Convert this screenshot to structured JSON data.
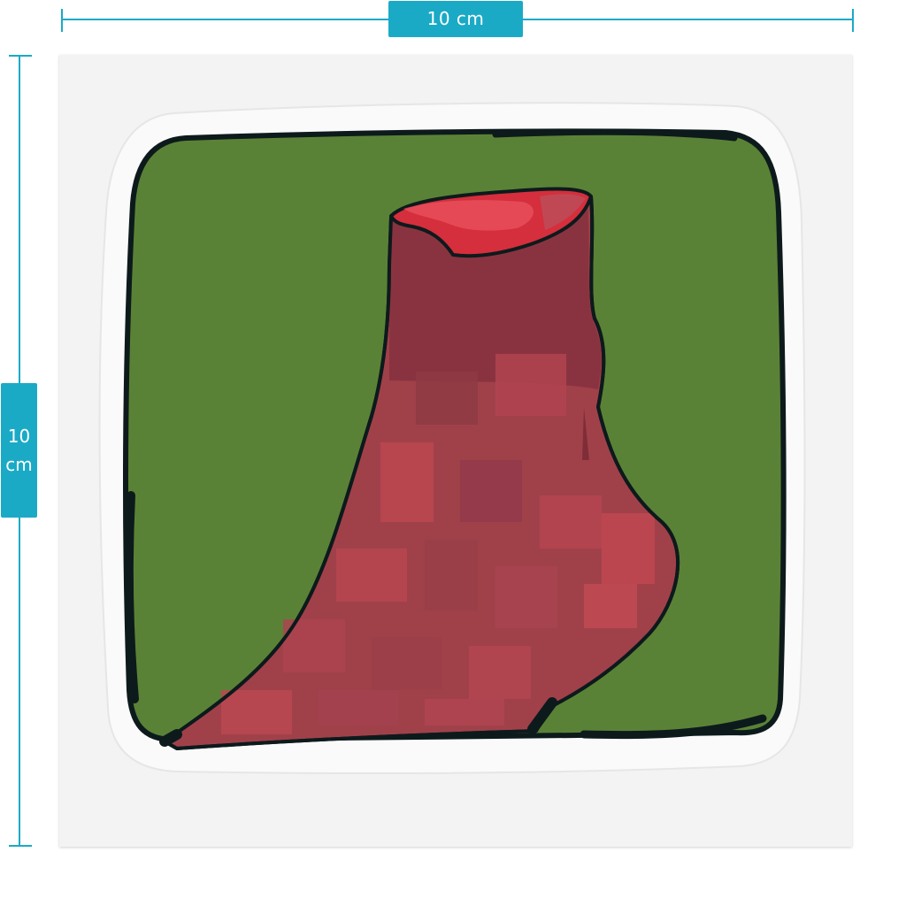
{
  "dimensions": {
    "width_label": "10 cm",
    "height_value": "10",
    "height_unit": "cm"
  },
  "colors": {
    "accent": "#1aaac6",
    "sheet": "#f3f3f3",
    "background_green": "#5a8236",
    "sock_main": "#a0414a",
    "sock_dark": "#8a3340",
    "sock_light": "#bd4750",
    "opening": "#d52e3c",
    "outline": "#0d1a1c"
  },
  "artwork": {
    "subject_icon": "sock-sticker-icon"
  }
}
